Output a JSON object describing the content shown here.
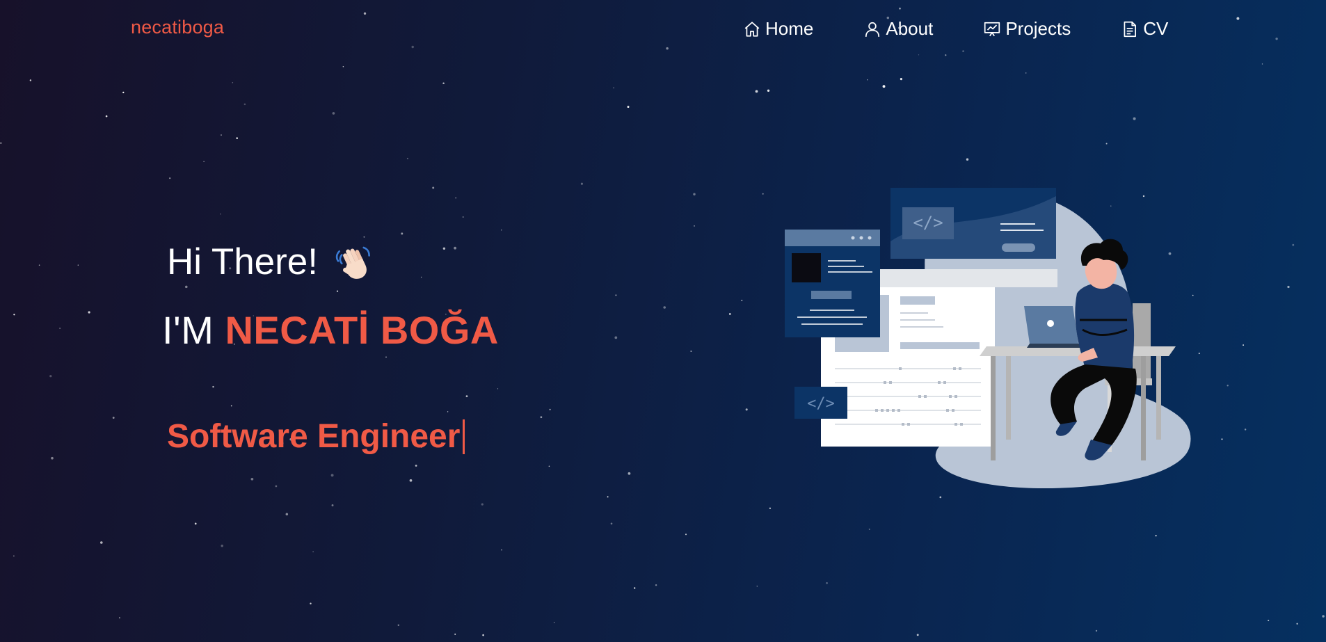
{
  "brand": {
    "logo_text": "necatiboga"
  },
  "nav": {
    "items": [
      {
        "label": "Home",
        "icon": "home-icon"
      },
      {
        "label": "About",
        "icon": "user-icon"
      },
      {
        "label": "Projects",
        "icon": "presentation-icon"
      },
      {
        "label": "CV",
        "icon": "document-icon"
      }
    ]
  },
  "hero": {
    "greeting": "Hi There!",
    "greeting_icon": "waving-hand-icon",
    "name_prefix": "I'M",
    "name": "NECATİ BOĞA",
    "role": "Software Engineer"
  },
  "colors": {
    "accent": "#f05a46",
    "text": "#ffffff",
    "background_start": "#17112a",
    "background_end": "#053060"
  },
  "illustration": {
    "subject": "developer-at-laptop-illustration"
  }
}
